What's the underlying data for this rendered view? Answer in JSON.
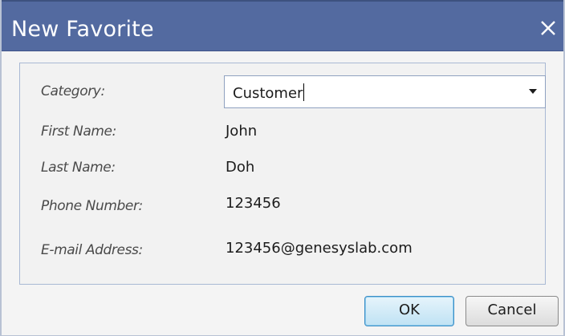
{
  "window": {
    "title": "New Favorite",
    "close_icon": "close-icon"
  },
  "form": {
    "category": {
      "label": "Category:",
      "value": "Customer"
    },
    "first_name": {
      "label": "First Name:",
      "value": "John"
    },
    "last_name": {
      "label": "Last Name:",
      "value": "Doh"
    },
    "phone": {
      "label": "Phone Number:",
      "value": "123456"
    },
    "email": {
      "label": "E-mail Address:",
      "value": "123456@genesyslab.com"
    }
  },
  "buttons": {
    "ok_label": "OK",
    "cancel_label": "Cancel"
  },
  "colors": {
    "titlebar": "#536aa0",
    "panel_border": "#a9b9d4",
    "ok_border": "#3d8fc6"
  }
}
